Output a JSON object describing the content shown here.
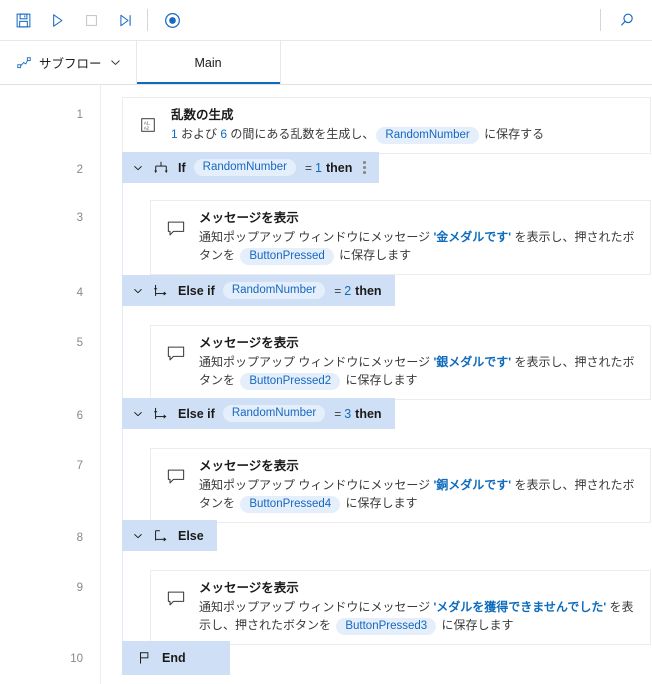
{
  "toolbar": {
    "buttons": [
      {
        "name": "save-button",
        "icon": "save-icon",
        "title": "保存"
      },
      {
        "name": "run-button",
        "icon": "play-icon",
        "title": "実行"
      },
      {
        "name": "stop-button",
        "icon": "stop-icon",
        "title": "停止"
      },
      {
        "name": "step-button",
        "icon": "step-into-icon",
        "title": "次のアクションを実行"
      },
      {
        "name": "recorder-button",
        "icon": "recorder-icon",
        "title": "レコーダー"
      }
    ],
    "search": {
      "name": "search-button",
      "icon": "search-icon",
      "title": "検索"
    }
  },
  "tabstrip": {
    "subflow_label": "サブフロー",
    "subflow_icon": "subflow-icon",
    "chevron_icon": "chevron-down-icon",
    "tabs": [
      {
        "label": "Main",
        "active": true
      }
    ]
  },
  "gutter": {
    "line_numbers": [
      "1",
      "2",
      "3",
      "4",
      "5",
      "6",
      "7",
      "8",
      "9",
      "10"
    ]
  },
  "flow": {
    "rows": [
      {
        "line": "1",
        "type": "action",
        "indent": 0,
        "icon": "random-number-icon",
        "title": "乱数の生成",
        "desc_parts": [
          {
            "t": "text",
            "v": ""
          },
          {
            "t": "num",
            "v": "1"
          },
          {
            "t": "text",
            "v": " および "
          },
          {
            "t": "num",
            "v": "6"
          },
          {
            "t": "text",
            "v": " の間にある乱数を生成し、"
          },
          {
            "t": "var",
            "v": "RandomNumber"
          },
          {
            "t": "text",
            "v": " に保存する"
          }
        ]
      },
      {
        "line": "2",
        "type": "control",
        "indent": 0,
        "icon": "if-icon",
        "keyword": "If",
        "variable": "RandomNumber",
        "operator": "=",
        "value": "1",
        "then": "then",
        "has_more": true
      },
      {
        "line": "3",
        "type": "action",
        "indent": 1,
        "icon": "display-message-icon",
        "title": "メッセージを表示",
        "desc_parts": [
          {
            "t": "text",
            "v": "通知ポップアップ ウィンドウにメッセージ "
          },
          {
            "t": "str",
            "v": "'金メダルです'"
          },
          {
            "t": "text",
            "v": " を表示し、押されたボタンを "
          },
          {
            "t": "var",
            "v": "ButtonPressed"
          },
          {
            "t": "text",
            "v": " に保存します"
          }
        ]
      },
      {
        "line": "4",
        "type": "control",
        "indent": 0,
        "icon": "else-if-icon",
        "keyword": "Else if",
        "variable": "RandomNumber",
        "operator": "=",
        "value": "2",
        "then": "then",
        "has_more": false
      },
      {
        "line": "5",
        "type": "action",
        "indent": 1,
        "icon": "display-message-icon",
        "title": "メッセージを表示",
        "desc_parts": [
          {
            "t": "text",
            "v": "通知ポップアップ ウィンドウにメッセージ "
          },
          {
            "t": "str",
            "v": "'銀メダルです'"
          },
          {
            "t": "text",
            "v": " を表示し、押されたボタンを "
          },
          {
            "t": "var",
            "v": "ButtonPressed2"
          },
          {
            "t": "text",
            "v": " に保存します"
          }
        ]
      },
      {
        "line": "6",
        "type": "control",
        "indent": 0,
        "icon": "else-if-icon",
        "keyword": "Else if",
        "variable": "RandomNumber",
        "operator": "=",
        "value": "3",
        "then": "then",
        "has_more": false
      },
      {
        "line": "7",
        "type": "action",
        "indent": 1,
        "icon": "display-message-icon",
        "title": "メッセージを表示",
        "desc_parts": [
          {
            "t": "text",
            "v": "通知ポップアップ ウィンドウにメッセージ "
          },
          {
            "t": "str",
            "v": "'銅メダルです'"
          },
          {
            "t": "text",
            "v": " を表示し、押されたボタンを "
          },
          {
            "t": "var",
            "v": "ButtonPressed4"
          },
          {
            "t": "text",
            "v": " に保存します"
          }
        ]
      },
      {
        "line": "8",
        "type": "control",
        "indent": 0,
        "icon": "else-icon",
        "keyword": "Else",
        "variable": "",
        "operator": "",
        "value": "",
        "then": "",
        "has_more": false
      },
      {
        "line": "9",
        "type": "action",
        "indent": 1,
        "icon": "display-message-icon",
        "title": "メッセージを表示",
        "desc_parts": [
          {
            "t": "text",
            "v": "通知ポップアップ ウィンドウにメッセージ "
          },
          {
            "t": "str",
            "v": "'メダルを獲得できませんでした'"
          },
          {
            "t": "text",
            "v": " を表示し、押されたボタンを "
          },
          {
            "t": "var",
            "v": "ButtonPressed3"
          },
          {
            "t": "text",
            "v": " に保存します"
          }
        ]
      },
      {
        "line": "10",
        "type": "end",
        "indent": 0,
        "icon": "flag-icon",
        "keyword": "End"
      }
    ]
  },
  "colors": {
    "accent": "#0f6cbd",
    "control_block_bg": "#cfe0f6",
    "variable_chip_bg": "#e5eefb",
    "variable_chip_fg": "#1668c1"
  }
}
